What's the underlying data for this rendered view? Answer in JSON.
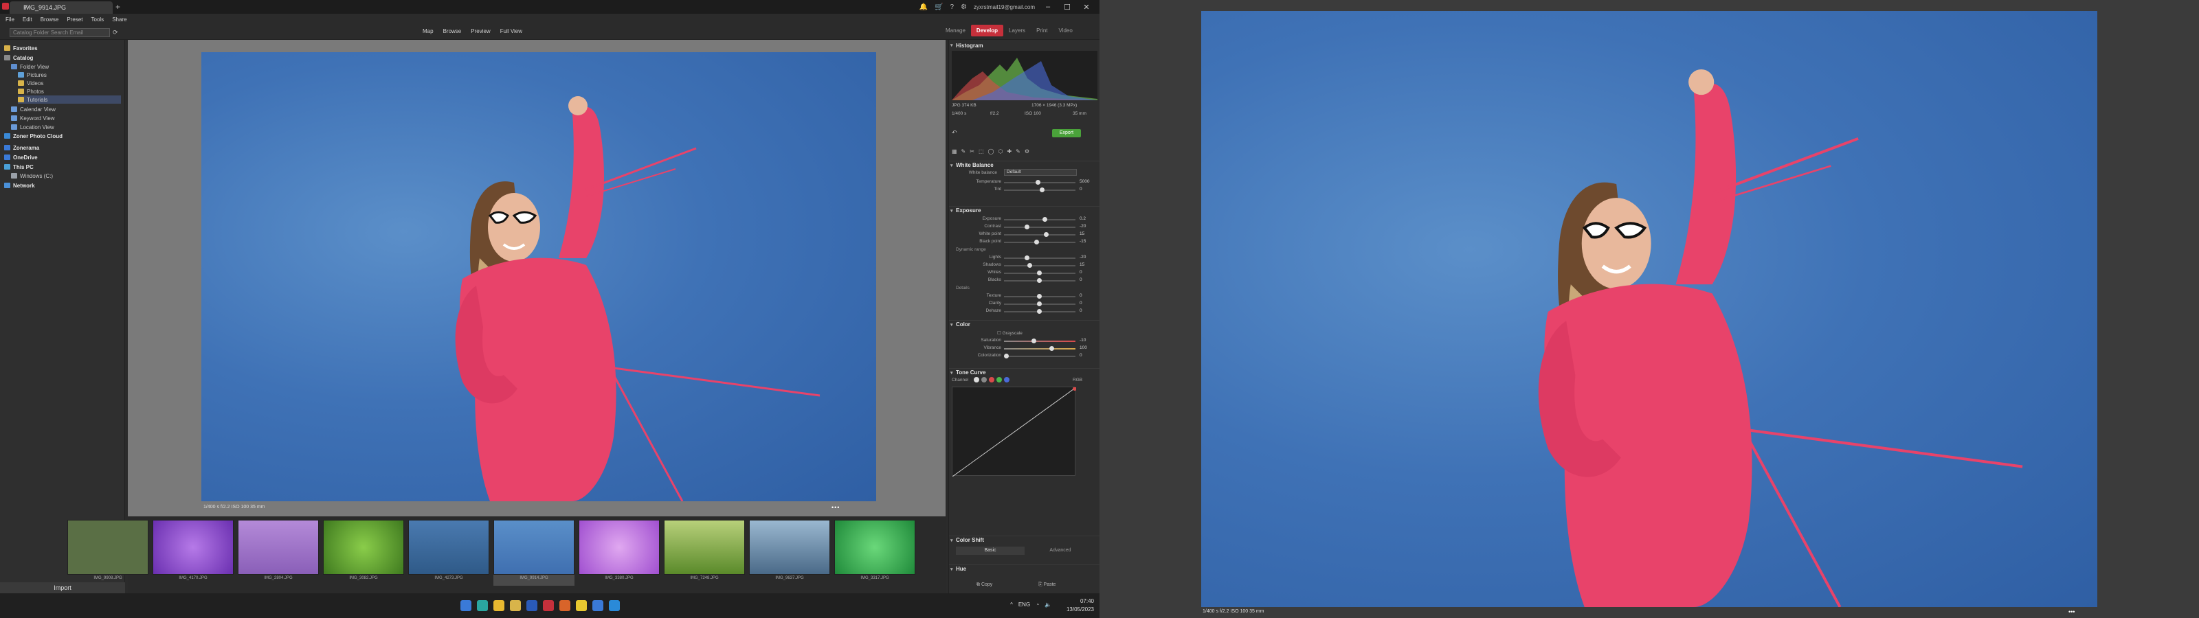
{
  "window": {
    "tab_title": "IMG_9914.JPG",
    "user_email": "zyxrstmail19@gmail.com"
  },
  "menu": [
    "File",
    "Edit",
    "Browse",
    "Preset",
    "Tools",
    "Share"
  ],
  "search": {
    "placeholder": "Catalog Folder Search Email"
  },
  "view_modes": [
    "Map",
    "Browse",
    "Preview",
    "Full View"
  ],
  "modules": {
    "manager": "Manage",
    "develop": "Develop",
    "layers": "Layers",
    "print": "Print",
    "video": "Video"
  },
  "sidebar": {
    "items": [
      {
        "label": "Favorites",
        "bold": true
      },
      {
        "label": "Catalog",
        "bold": true
      },
      {
        "label": "Folder View"
      },
      {
        "label": "Pictures"
      },
      {
        "label": "Videos"
      },
      {
        "label": "Photos"
      },
      {
        "label": "Tutorials"
      },
      {
        "label": "Calendar View"
      },
      {
        "label": "Keyword View"
      },
      {
        "label": "Location View"
      },
      {
        "label": "Zoner Photo Cloud",
        "bold": true
      },
      {
        "label": "Zonerama",
        "bold": true
      },
      {
        "label": "OneDrive",
        "bold": true
      },
      {
        "label": "This PC",
        "bold": true
      },
      {
        "label": "Windows (C:)"
      },
      {
        "label": "Network",
        "bold": true
      }
    ],
    "import_label": "Import"
  },
  "viewer": {
    "info": "1/400 s  f/2.2  ISO 100  35 mm"
  },
  "filmstrip": [
    {
      "caption": "IMG_9908.JPG",
      "color": "#5a6f45"
    },
    {
      "caption": "IMG_4170.JPG",
      "color": "#8a4fc9"
    },
    {
      "caption": "IMG_2804.JPG",
      "color": "#b48ad8"
    },
    {
      "caption": "IMG_3082.JPG",
      "color": "#4f8a2a"
    },
    {
      "caption": "IMG_4273.JPG",
      "color": "#3d6a9e"
    },
    {
      "caption": "IMG_9914.JPG",
      "color": "#4a78b8"
    },
    {
      "caption": "IMG_3380.JPG",
      "color": "#c67ae0"
    },
    {
      "caption": "IMG_7248.JPG",
      "color": "#7ea24a"
    },
    {
      "caption": "IMG_9637.JPG",
      "color": "#6a8fb0"
    },
    {
      "caption": "IMG_3317.JPG",
      "color": "#2aa64a"
    }
  ],
  "rpanel": {
    "histogram": "Histogram",
    "file_info_1": "JPG  374 KB",
    "file_info_2": "1706 × 1946 (3.3 MPx)",
    "exif_1": "1/400 s",
    "exif_2": "f/2.2",
    "exif_3": "ISO 100",
    "exif_4": "35 mm",
    "export": "Export",
    "white_balance": "White Balance",
    "wb_label": "White balance",
    "wb_value": "Default",
    "temperature": {
      "label": "Temperature",
      "value": "5000"
    },
    "tint": {
      "label": "Tint",
      "value": "0"
    },
    "exposure": "Exposure",
    "exposure_rows": [
      {
        "label": "Exposure",
        "value": "0.2"
      },
      {
        "label": "Contrast",
        "value": "-20"
      },
      {
        "label": "White point",
        "value": "15"
      },
      {
        "label": "Black point",
        "value": "-15"
      }
    ],
    "dynamic_range": "Dynamic range",
    "dr_rows": [
      {
        "label": "Lights",
        "value": "-20"
      },
      {
        "label": "Shadows",
        "value": "15"
      },
      {
        "label": "Whites",
        "value": "0"
      },
      {
        "label": "Blacks",
        "value": "0"
      }
    ],
    "details": "Details",
    "detail_rows": [
      {
        "label": "Texture",
        "value": "0"
      },
      {
        "label": "Clarity",
        "value": "0"
      },
      {
        "label": "Dehaze",
        "value": "0"
      }
    ],
    "color": "Color",
    "grayscale": "Grayscale",
    "color_rows": [
      {
        "label": "Saturation",
        "value": "-10"
      },
      {
        "label": "Vibrance",
        "value": "100"
      },
      {
        "label": "Colorization",
        "value": "0"
      }
    ],
    "tone_curve": "Tone Curve",
    "channel": "Channel",
    "rgb": "RGB",
    "color_shift": "Color Shift",
    "basic": "Basic",
    "advanced": "Advanced",
    "hue": "Hue",
    "copy": "Copy",
    "paste": "Paste"
  },
  "taskbar": {
    "lang": "ENG",
    "time": "07:40",
    "date": "13/05/2023"
  },
  "right_monitor": {
    "info": "1/400 s  f/2.2  ISO 100  35 mm"
  }
}
